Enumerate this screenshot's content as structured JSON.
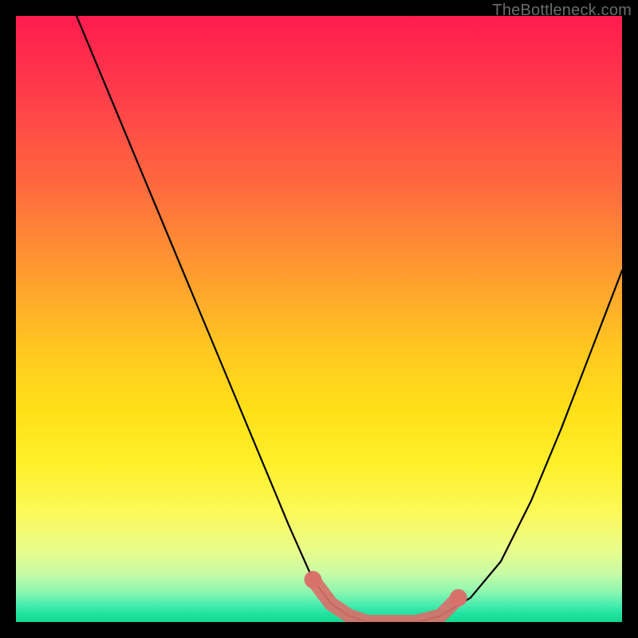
{
  "watermark": "TheBottleneck.com",
  "chart_data": {
    "type": "line",
    "title": "",
    "xlabel": "",
    "ylabel": "",
    "xlim": [
      0,
      100
    ],
    "ylim": [
      0,
      100
    ],
    "grid": false,
    "series": [
      {
        "name": "bottleneck-curve",
        "color": "#000000",
        "x": [
          10,
          15,
          20,
          25,
          30,
          35,
          40,
          45,
          49,
          52,
          55,
          58,
          62,
          66,
          70,
          75,
          80,
          85,
          90,
          95,
          100
        ],
        "values": [
          100,
          88,
          76,
          64,
          52,
          40,
          28,
          16,
          7,
          3,
          1,
          0,
          0,
          0,
          1,
          4,
          10,
          20,
          32,
          45,
          58
        ]
      }
    ],
    "markers": {
      "name": "highlight-points",
      "color": "#d9706a",
      "x": [
        49,
        52,
        55,
        58,
        62,
        66,
        70,
        71,
        73
      ],
      "values": [
        7,
        3,
        1,
        0,
        0,
        0,
        1,
        2,
        4
      ]
    },
    "background_gradient": {
      "top": "#ff1b4e",
      "mid_upper": "#ff9a30",
      "mid": "#ffe018",
      "mid_lower": "#fcf95a",
      "bottom": "#14d990"
    }
  }
}
